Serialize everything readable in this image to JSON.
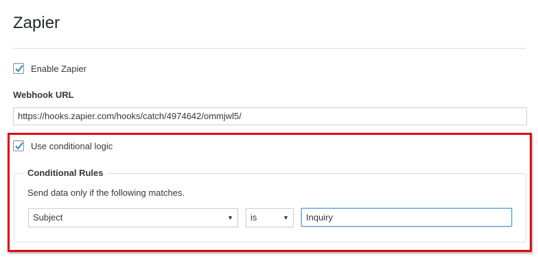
{
  "page": {
    "title": "Zapier"
  },
  "enable": {
    "label": "Enable Zapier",
    "checked": true
  },
  "webhook": {
    "label": "Webhook URL",
    "value": "https://hooks.zapier.com/hooks/catch/4974642/ommjwl5/"
  },
  "conditional": {
    "label": "Use conditional logic",
    "checked": true
  },
  "rules": {
    "legend": "Conditional Rules",
    "description": "Send data only if the following matches.",
    "field_select": "Subject",
    "operator_select": "is",
    "value": "Inquiry"
  },
  "icons": {
    "checkmark": "checkmark-icon",
    "dropdown": "chevron-down-icon"
  },
  "colors": {
    "accent": "#1e8cbe",
    "highlight": "#e0040b"
  }
}
